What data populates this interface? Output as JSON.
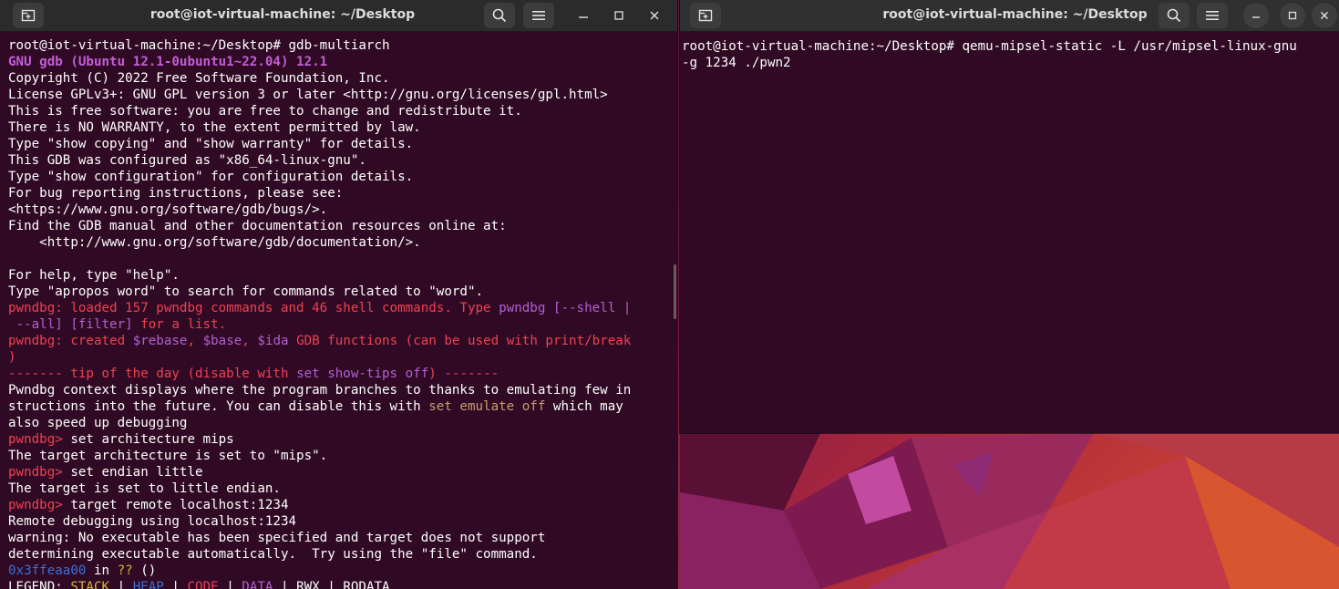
{
  "desktop": {
    "wallpaper": "ubuntu-jammy-jellyfish"
  },
  "left_window": {
    "title": "root@iot-virtual-machine: ~/Desktop",
    "icons": {
      "new_tab": "new-tab-icon",
      "search": "search-icon",
      "menu": "hamburger-icon",
      "minimize": "minimize-icon",
      "maximize": "maximize-icon",
      "close": "close-icon"
    },
    "lines": [
      [
        {
          "t": "root@iot-virtual-machine:~/Desktop# gdb-multiarch"
        }
      ],
      [
        {
          "t": "GNU gdb (Ubuntu 12.1-0ubuntu1~22.04) 12.1",
          "c": "purple"
        }
      ],
      [
        {
          "t": "Copyright (C) 2022 Free Software Foundation, Inc."
        }
      ],
      [
        {
          "t": "License GPLv3+: GNU GPL version 3 or later <http://gnu.org/licenses/gpl.html>"
        }
      ],
      [
        {
          "t": "This is free software: you are free to change and redistribute it."
        }
      ],
      [
        {
          "t": "There is NO WARRANTY, to the extent permitted by law."
        }
      ],
      [
        {
          "t": "Type \"show copying\" and \"show warranty\" for details."
        }
      ],
      [
        {
          "t": "This GDB was configured as \"x86_64-linux-gnu\"."
        }
      ],
      [
        {
          "t": "Type \"show configuration\" for configuration details."
        }
      ],
      [
        {
          "t": "For bug reporting instructions, please see:"
        }
      ],
      [
        {
          "t": "<https://www.gnu.org/software/gdb/bugs/>."
        }
      ],
      [
        {
          "t": "Find the GDB manual and other documentation resources online at:"
        }
      ],
      [
        {
          "t": "    <http://www.gnu.org/software/gdb/documentation/>."
        }
      ],
      [
        {
          "t": ""
        }
      ],
      [
        {
          "t": "For help, type \"help\"."
        }
      ],
      [
        {
          "t": "Type \"apropos word\" to search for commands related to \"word\"."
        }
      ],
      [
        {
          "t": "pwndbg: ",
          "c": "red"
        },
        {
          "t": "loaded 157 pwndbg commands and 46 shell commands. Type ",
          "c": "red"
        },
        {
          "t": "pwndbg [--shell |",
          "c": "mag"
        }
      ],
      [
        {
          "t": " --all] [filter]",
          "c": "mag"
        },
        {
          "t": " for a list.",
          "c": "red"
        }
      ],
      [
        {
          "t": "pwndbg: ",
          "c": "red"
        },
        {
          "t": "created ",
          "c": "red"
        },
        {
          "t": "$rebase",
          "c": "mag"
        },
        {
          "t": ", ",
          "c": "red"
        },
        {
          "t": "$base",
          "c": "mag"
        },
        {
          "t": ", ",
          "c": "red"
        },
        {
          "t": "$ida",
          "c": "mag"
        },
        {
          "t": " GDB functions (can be used with print/break",
          "c": "red"
        }
      ],
      [
        {
          "t": ")",
          "c": "red"
        }
      ],
      [
        {
          "t": "------- tip of the day ",
          "c": "red"
        },
        {
          "t": "(disable with ",
          "c": "red"
        },
        {
          "t": "set show-tips off",
          "c": "mag"
        },
        {
          "t": ") -------",
          "c": "red"
        }
      ],
      [
        {
          "t": "Pwndbg context displays where the program branches to thanks to emulating few in"
        }
      ],
      [
        {
          "t": "structions into the future. You can disable this with "
        },
        {
          "t": "set emulate off",
          "c": "brown"
        },
        {
          "t": " which may"
        }
      ],
      [
        {
          "t": "also speed up debugging"
        }
      ],
      [
        {
          "t": "pwndbg> ",
          "c": "red"
        },
        {
          "t": "set architecture mips"
        }
      ],
      [
        {
          "t": "The target architecture is set to \"mips\"."
        }
      ],
      [
        {
          "t": "pwndbg> ",
          "c": "red"
        },
        {
          "t": "set endian little"
        }
      ],
      [
        {
          "t": "The target is set to little endian."
        }
      ],
      [
        {
          "t": "pwndbg> ",
          "c": "red"
        },
        {
          "t": "target remote localhost:1234"
        }
      ],
      [
        {
          "t": "Remote debugging using localhost:1234"
        }
      ],
      [
        {
          "t": "warning: No executable has been specified and target does not support"
        }
      ],
      [
        {
          "t": "determining executable automatically.  Try using the \"file\" command."
        }
      ],
      [
        {
          "t": "0x3ffeaa00",
          "c": "blue"
        },
        {
          "t": " in "
        },
        {
          "t": "??",
          "c": "yellow"
        },
        {
          "t": " ()"
        }
      ],
      [
        {
          "t": "LEGEND: "
        },
        {
          "t": "STACK",
          "c": "yellow"
        },
        {
          "t": " | "
        },
        {
          "t": "HEAP",
          "c": "blue"
        },
        {
          "t": " | "
        },
        {
          "t": "CODE",
          "c": "red"
        },
        {
          "t": " | "
        },
        {
          "t": "DATA",
          "c": "mag"
        },
        {
          "t": " | RWX | RODATA"
        }
      ]
    ]
  },
  "right_window": {
    "title": "root@iot-virtual-machine: ~/Desktop",
    "icons": {
      "new_tab": "new-tab-icon",
      "search": "search-icon",
      "menu": "hamburger-icon",
      "minimize": "minimize-icon",
      "maximize": "maximize-icon",
      "close": "close-icon"
    },
    "lines": [
      [
        {
          "t": "root@iot-virtual-machine:~/Desktop# qemu-mipsel-static -L /usr/mipsel-linux-gnu"
        }
      ],
      [
        {
          "t": "-g 1234 ./pwn2"
        }
      ]
    ]
  }
}
